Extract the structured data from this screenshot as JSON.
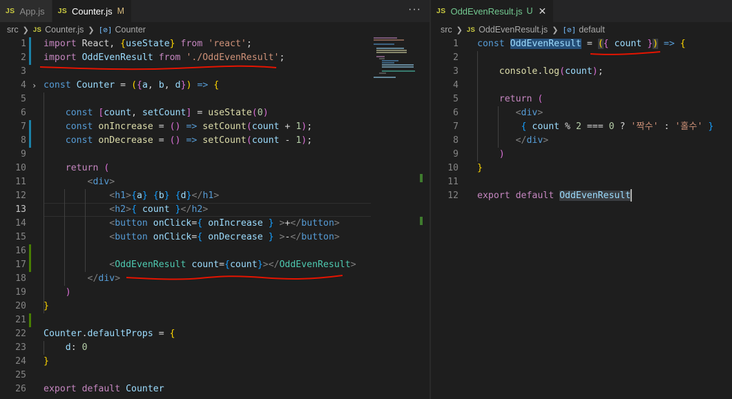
{
  "left_editor": {
    "tabs": [
      {
        "icon": "JS",
        "label": "App.js",
        "active": false
      },
      {
        "icon": "JS",
        "label": "Counter.js",
        "active": true,
        "status": "M"
      }
    ],
    "more_label": "···",
    "breadcrumb": {
      "folder": "src",
      "icon": "JS",
      "file": "Counter.js",
      "symbol_icon": "[⊘]",
      "symbol": "Counter"
    },
    "line_numbers": [
      "1",
      "2",
      "3",
      "4",
      "5",
      "6",
      "7",
      "8",
      "9",
      "10",
      "11",
      "12",
      "13",
      "14",
      "15",
      "16",
      "17",
      "18",
      "19",
      "20",
      "21",
      "22",
      "23",
      "24",
      "25",
      "26"
    ],
    "fold_arrow": "›",
    "code": {
      "l1": [
        {
          "t": "import",
          "c": "kw2"
        },
        {
          "t": " React, ",
          "c": "pl"
        },
        {
          "t": "{",
          "c": "br"
        },
        {
          "t": "useState",
          "c": "id"
        },
        {
          "t": "}",
          "c": "br"
        },
        {
          "t": " from ",
          "c": "kw2"
        },
        {
          "t": "'react'",
          "c": "str"
        },
        {
          "t": ";",
          "c": "pl"
        }
      ],
      "l2": [
        {
          "t": "import",
          "c": "kw2"
        },
        {
          "t": " OddEvenResult ",
          "c": "id"
        },
        {
          "t": "from",
          "c": "kw2"
        },
        {
          "t": " ",
          "c": "pl"
        },
        {
          "t": "'./OddEvenResult'",
          "c": "str"
        },
        {
          "t": ";",
          "c": "pl"
        }
      ],
      "l4": [
        {
          "t": "const",
          "c": "kw"
        },
        {
          "t": " Counter ",
          "c": "id"
        },
        {
          "t": "= ",
          "c": "pl"
        },
        {
          "t": "(",
          "c": "br"
        },
        {
          "t": "{",
          "c": "br2"
        },
        {
          "t": "a",
          "c": "id"
        },
        {
          "t": ", ",
          "c": "pl"
        },
        {
          "t": "b",
          "c": "id"
        },
        {
          "t": ", ",
          "c": "pl"
        },
        {
          "t": "d",
          "c": "id"
        },
        {
          "t": "}",
          "c": "br2"
        },
        {
          "t": ")",
          "c": "br"
        },
        {
          "t": " => ",
          "c": "kw"
        },
        {
          "t": "{",
          "c": "br"
        }
      ],
      "l6": [
        {
          "t": "    const",
          "c": "kw"
        },
        {
          "t": " [",
          "c": "br2"
        },
        {
          "t": "count",
          "c": "id"
        },
        {
          "t": ", ",
          "c": "pl"
        },
        {
          "t": "setCount",
          "c": "id"
        },
        {
          "t": "]",
          "c": "br2"
        },
        {
          "t": " = ",
          "c": "pl"
        },
        {
          "t": "useState",
          "c": "fn"
        },
        {
          "t": "(",
          "c": "br2"
        },
        {
          "t": "0",
          "c": "num"
        },
        {
          "t": ")",
          "c": "br2"
        }
      ],
      "l7": [
        {
          "t": "    const",
          "c": "kw"
        },
        {
          "t": " onIncrease ",
          "c": "fn"
        },
        {
          "t": "= ",
          "c": "pl"
        },
        {
          "t": "()",
          "c": "br2"
        },
        {
          "t": " => ",
          "c": "kw"
        },
        {
          "t": "setCount",
          "c": "fn"
        },
        {
          "t": "(",
          "c": "br2"
        },
        {
          "t": "count",
          "c": "id"
        },
        {
          "t": " + ",
          "c": "pl"
        },
        {
          "t": "1",
          "c": "num"
        },
        {
          "t": ")",
          "c": "br2"
        },
        {
          "t": ";",
          "c": "pl"
        }
      ],
      "l8": [
        {
          "t": "    const",
          "c": "kw"
        },
        {
          "t": " onDecrease ",
          "c": "fn"
        },
        {
          "t": "= ",
          "c": "pl"
        },
        {
          "t": "()",
          "c": "br2"
        },
        {
          "t": " => ",
          "c": "kw"
        },
        {
          "t": "setCount",
          "c": "fn"
        },
        {
          "t": "(",
          "c": "br2"
        },
        {
          "t": "count",
          "c": "id"
        },
        {
          "t": " - ",
          "c": "pl"
        },
        {
          "t": "1",
          "c": "num"
        },
        {
          "t": ")",
          "c": "br2"
        },
        {
          "t": ";",
          "c": "pl"
        }
      ],
      "l10": [
        {
          "t": "    return",
          "c": "kw2"
        },
        {
          "t": " (",
          "c": "br2"
        }
      ],
      "l11": [
        {
          "t": "        <",
          "c": "tag"
        },
        {
          "t": "div",
          "c": "tn"
        },
        {
          "t": ">",
          "c": "tag"
        }
      ],
      "l12": [
        {
          "t": "            <",
          "c": "tag"
        },
        {
          "t": "h1",
          "c": "tn"
        },
        {
          "t": ">",
          "c": "tag"
        },
        {
          "t": "{",
          "c": "br3"
        },
        {
          "t": "a",
          "c": "id"
        },
        {
          "t": "}",
          "c": "br3"
        },
        {
          "t": " ",
          "c": "pl"
        },
        {
          "t": "{",
          "c": "br3"
        },
        {
          "t": "b",
          "c": "id"
        },
        {
          "t": "}",
          "c": "br3"
        },
        {
          "t": " ",
          "c": "pl"
        },
        {
          "t": "{",
          "c": "br3"
        },
        {
          "t": "d",
          "c": "id"
        },
        {
          "t": "}",
          "c": "br3"
        },
        {
          "t": "</",
          "c": "tag"
        },
        {
          "t": "h1",
          "c": "tn"
        },
        {
          "t": ">",
          "c": "tag"
        }
      ],
      "l13": [
        {
          "t": "            <",
          "c": "tag"
        },
        {
          "t": "h2",
          "c": "tn"
        },
        {
          "t": ">",
          "c": "tag"
        },
        {
          "t": "{",
          "c": "br3"
        },
        {
          "t": " count ",
          "c": "id"
        },
        {
          "t": "}",
          "c": "br3"
        },
        {
          "t": "</",
          "c": "tag"
        },
        {
          "t": "h2",
          "c": "tn"
        },
        {
          "t": ">",
          "c": "tag"
        }
      ],
      "l14": [
        {
          "t": "            <",
          "c": "tag"
        },
        {
          "t": "button",
          "c": "tn"
        },
        {
          "t": " onClick",
          "c": "id"
        },
        {
          "t": "=",
          "c": "pl"
        },
        {
          "t": "{",
          "c": "br3"
        },
        {
          "t": " onIncrease ",
          "c": "id"
        },
        {
          "t": "}",
          "c": "br3"
        },
        {
          "t": " >",
          "c": "tag"
        },
        {
          "t": "+",
          "c": "pl"
        },
        {
          "t": "</",
          "c": "tag"
        },
        {
          "t": "button",
          "c": "tn"
        },
        {
          "t": ">",
          "c": "tag"
        }
      ],
      "l15": [
        {
          "t": "            <",
          "c": "tag"
        },
        {
          "t": "button",
          "c": "tn"
        },
        {
          "t": " onClick",
          "c": "id"
        },
        {
          "t": "=",
          "c": "pl"
        },
        {
          "t": "{",
          "c": "br3"
        },
        {
          "t": " onDecrease ",
          "c": "id"
        },
        {
          "t": "}",
          "c": "br3"
        },
        {
          "t": " >",
          "c": "tag"
        },
        {
          "t": "-",
          "c": "pl"
        },
        {
          "t": "</",
          "c": "tag"
        },
        {
          "t": "button",
          "c": "tn"
        },
        {
          "t": ">",
          "c": "tag"
        }
      ],
      "l17": [
        {
          "t": "            <",
          "c": "tag"
        },
        {
          "t": "OddEvenResult",
          "c": "cmp"
        },
        {
          "t": " count",
          "c": "id"
        },
        {
          "t": "=",
          "c": "pl"
        },
        {
          "t": "{",
          "c": "br3"
        },
        {
          "t": "count",
          "c": "id"
        },
        {
          "t": "}",
          "c": "br3"
        },
        {
          "t": "></",
          "c": "tag"
        },
        {
          "t": "OddEvenResult",
          "c": "cmp"
        },
        {
          "t": ">",
          "c": "tag"
        }
      ],
      "l18": [
        {
          "t": "        </",
          "c": "tag"
        },
        {
          "t": "div",
          "c": "tn"
        },
        {
          "t": ">",
          "c": "tag"
        }
      ],
      "l19": [
        {
          "t": "    )",
          "c": "br2"
        }
      ],
      "l20": [
        {
          "t": "}",
          "c": "br"
        }
      ],
      "l22": [
        {
          "t": "Counter",
          "c": "id"
        },
        {
          "t": ".",
          "c": "pl"
        },
        {
          "t": "defaultProps",
          "c": "id"
        },
        {
          "t": " = ",
          "c": "pl"
        },
        {
          "t": "{",
          "c": "br"
        }
      ],
      "l23": [
        {
          "t": "    d",
          "c": "id"
        },
        {
          "t": ": ",
          "c": "pl"
        },
        {
          "t": "0",
          "c": "num"
        }
      ],
      "l24": [
        {
          "t": "}",
          "c": "br"
        }
      ],
      "l26": [
        {
          "t": "export",
          "c": "kw2"
        },
        {
          "t": " default ",
          "c": "kw2"
        },
        {
          "t": "Counter",
          "c": "id"
        }
      ]
    }
  },
  "right_editor": {
    "tab": {
      "icon": "JS",
      "label": "OddEvenResult.js",
      "status": "U",
      "close": "✕"
    },
    "breadcrumb": {
      "folder": "src",
      "icon": "JS",
      "file": "OddEvenResult.js",
      "symbol_icon": "[⊘]",
      "symbol": "default"
    },
    "line_numbers": [
      "1",
      "2",
      "3",
      "4",
      "5",
      "6",
      "7",
      "8",
      "9",
      "10",
      "11",
      "12"
    ],
    "code": {
      "l1": [
        {
          "t": "const",
          "c": "kw"
        },
        {
          "t": " ",
          "c": "pl"
        },
        {
          "t": "OddEvenResult",
          "c": "id hl"
        },
        {
          "t": " = ",
          "c": "pl"
        },
        {
          "t": "(",
          "c": "br hl2"
        },
        {
          "t": "{",
          "c": "br2"
        },
        {
          "t": " count ",
          "c": "id"
        },
        {
          "t": "}",
          "c": "br2"
        },
        {
          "t": ")",
          "c": "br hl2"
        },
        {
          "t": " => ",
          "c": "kw"
        },
        {
          "t": "{",
          "c": "br"
        }
      ],
      "l3": [
        {
          "t": "    console",
          "c": "fn"
        },
        {
          "t": ".",
          "c": "pl"
        },
        {
          "t": "log",
          "c": "fn"
        },
        {
          "t": "(",
          "c": "br2"
        },
        {
          "t": "count",
          "c": "id"
        },
        {
          "t": ")",
          "c": "br2"
        },
        {
          "t": ";",
          "c": "pl"
        }
      ],
      "l5": [
        {
          "t": "    return",
          "c": "kw2"
        },
        {
          "t": " (",
          "c": "br2"
        }
      ],
      "l6": [
        {
          "t": "       <",
          "c": "tag"
        },
        {
          "t": "div",
          "c": "tn"
        },
        {
          "t": ">",
          "c": "tag"
        }
      ],
      "l7": [
        {
          "t": "        {",
          "c": "br3"
        },
        {
          "t": " count ",
          "c": "id"
        },
        {
          "t": "% ",
          "c": "pl"
        },
        {
          "t": "2",
          "c": "num"
        },
        {
          "t": " === ",
          "c": "pl"
        },
        {
          "t": "0",
          "c": "num"
        },
        {
          "t": " ? ",
          "c": "pl"
        },
        {
          "t": "'짝수'",
          "c": "str"
        },
        {
          "t": " : ",
          "c": "pl"
        },
        {
          "t": "'홀수'",
          "c": "str"
        },
        {
          "t": " }",
          "c": "br3"
        }
      ],
      "l8": [
        {
          "t": "       </",
          "c": "tag"
        },
        {
          "t": "div",
          "c": "tn"
        },
        {
          "t": ">",
          "c": "tag"
        }
      ],
      "l9": [
        {
          "t": "    )",
          "c": "br2"
        }
      ],
      "l10": [
        {
          "t": "}",
          "c": "br"
        }
      ],
      "l12": [
        {
          "t": "export",
          "c": "kw2"
        },
        {
          "t": " default ",
          "c": "kw2"
        },
        {
          "t": "OddEvenResult",
          "c": "id hl2"
        }
      ]
    }
  },
  "colors": {
    "background": "#1e1e1e",
    "tab_bar": "#252526",
    "annotation_red": "#e51400",
    "git_modified": "#1b81a8",
    "git_added": "#487e02"
  }
}
